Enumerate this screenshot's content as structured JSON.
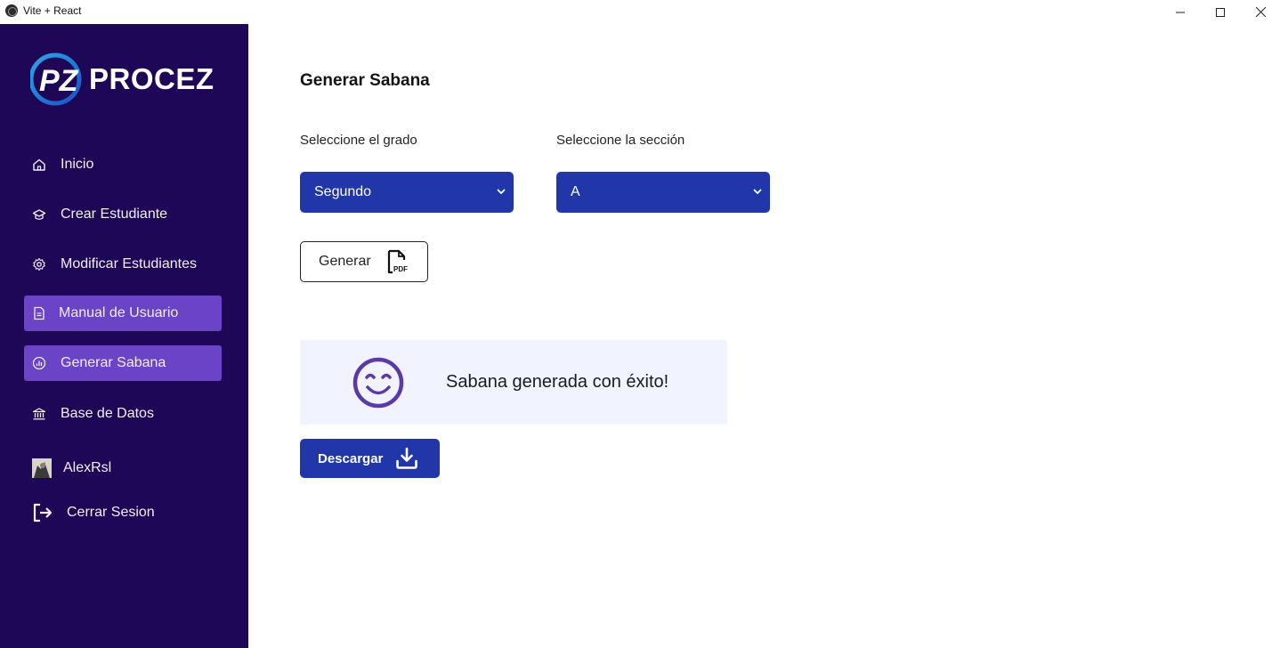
{
  "window": {
    "title": "Vite + React"
  },
  "brand": {
    "logo_text": "PROCEZ"
  },
  "sidebar": {
    "items": [
      {
        "label": "Inicio",
        "icon": "home-icon",
        "active": false
      },
      {
        "label": "Crear Estudiante",
        "icon": "graduation-cap-icon",
        "active": false
      },
      {
        "label": "Modificar Estudiantes",
        "icon": "gear-icon",
        "active": false
      },
      {
        "label": "Manual de Usuario",
        "icon": "document-icon",
        "active": true
      },
      {
        "label": "Generar Sabana",
        "icon": "chart-icon",
        "active": true
      },
      {
        "label": "Base de Datos",
        "icon": "bank-icon",
        "active": false
      }
    ],
    "user": {
      "name": "AlexRsl",
      "icon": "avatar"
    },
    "logout": {
      "label": "Cerrar Sesion",
      "icon": "logout-icon"
    }
  },
  "main": {
    "title": "Generar Sabana",
    "grade": {
      "label": "Seleccione el grado",
      "value": "Segundo"
    },
    "section": {
      "label": "Seleccione la sección",
      "value": "A"
    },
    "generate_button": {
      "label": "Generar",
      "icon": "pdf-file-icon"
    },
    "success": {
      "message": "Sabana generada con éxito!",
      "icon": "smile-icon"
    },
    "download_button": {
      "label": "Descargar",
      "icon": "download-icon"
    }
  },
  "colors": {
    "sidebar_bg": "#1e0757",
    "active_item": "#6a43c6",
    "primary": "#2136a8",
    "success_bg": "#f1f4fe",
    "smile": "#5b3aa8"
  }
}
